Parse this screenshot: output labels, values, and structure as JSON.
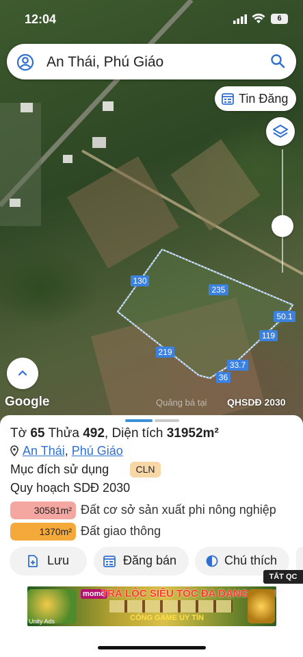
{
  "status_bar": {
    "time": "12:04",
    "battery": "6"
  },
  "search": {
    "query": "An Thái, Phú Giáo"
  },
  "map": {
    "listings_button": "Tin Đăng",
    "edge_labels": [
      "130",
      "235",
      "219",
      "50.1",
      "119",
      "33.7",
      "36"
    ],
    "google_logo": "Google",
    "ad_watermark": "Quảng bá tại",
    "plan_badge": "QHSDĐ 2030"
  },
  "parcel": {
    "to_label": "Tờ",
    "to_value": "65",
    "thua_label": "Thửa",
    "thua_value": "492",
    "area_label": "Diện tích",
    "area_value": "31952m²",
    "commune_link": "An Thái",
    "district_link": "Phú Giáo",
    "purpose_label": "Mục đích sử dụng",
    "purpose_code": "CLN",
    "plan_label": "Quy hoạch SDĐ 2030",
    "zones": [
      {
        "area": "30581m²",
        "desc": "Đất cơ sở sản xuất phi nông nghiệp",
        "color": "#f4a7a0"
      },
      {
        "area": "1370m²",
        "desc": "Đất giao thông",
        "color": "#f5a93b"
      }
    ]
  },
  "actions": {
    "save": "Lưu",
    "post": "Đăng bán",
    "legend": "Chú thích"
  },
  "ad": {
    "close_label": "TẮT QC",
    "brand": "momo",
    "headline": "TRẢ LỘC SIÊU TỐC ĐA DẠNG CHƠI",
    "subline": "CỔNG GAME UY TÍN",
    "network": "Unity Ads"
  }
}
